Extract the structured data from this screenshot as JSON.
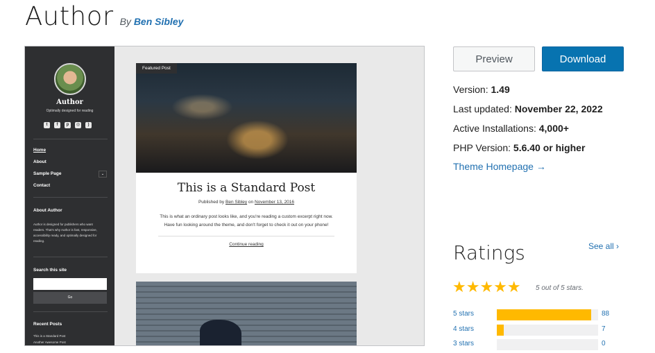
{
  "theme": {
    "title": "Author",
    "by_prefix": "By",
    "author": "Ben Sibley"
  },
  "screenshot": {
    "sidebar": {
      "site_name": "Author",
      "site_description": "Optimally designed for reading",
      "social_icons": [
        "twitter-icon",
        "facebook-icon",
        "pinterest-icon",
        "instagram-icon",
        "rss-icon"
      ],
      "menu": [
        "Home",
        "About",
        "Sample Page",
        "Contact"
      ],
      "submenu_toggle": "⌄",
      "about_heading": "About Author",
      "about_text": "Author is designed for publishers who want readers. That's why Author is fast, responsive, accessibility ready, and optimally designed for reading.",
      "search_heading": "Search this site",
      "search_button": "Go",
      "recent_heading": "Recent Posts",
      "recent_posts": [
        "This is a Standard Post",
        "Another Awesome Post"
      ]
    },
    "post": {
      "badge": "Featured Post",
      "title": "This is a Standard Post",
      "meta_prefix": "Published by",
      "meta_author": "Ben Sibley",
      "meta_on": "on",
      "meta_date": "November 13, 2016",
      "excerpt": "This is what an ordinary post looks like, and you're reading a custom excerpt right now. Have fun looking around the theme, and don't forget to check it out on your phone!",
      "continue": "Continue reading"
    }
  },
  "actions": {
    "preview": "Preview",
    "download": "Download"
  },
  "meta": {
    "version_label": "Version:",
    "version": "1.49",
    "updated_label": "Last updated:",
    "updated": "November 22, 2022",
    "installs_label": "Active Installations:",
    "installs": "4,000+",
    "php_label": "PHP Version:",
    "php": "5.6.40 or higher",
    "homepage": "Theme Homepage →"
  },
  "ratings": {
    "heading": "Ratings",
    "see_all": "See all ›",
    "stars_glyphs": "★★★★★",
    "summary": "5 out of 5 stars.",
    "rows": [
      {
        "label": "5 stars",
        "count": "88",
        "fraction": 0.93
      },
      {
        "label": "4 stars",
        "count": "7",
        "fraction": 0.07
      },
      {
        "label": "3 stars",
        "count": "0",
        "fraction": 0
      }
    ]
  },
  "colors": {
    "accent": "#2271b1",
    "download": "#0773b0",
    "star": "#ffb900",
    "sidebar": "#2e2f31"
  }
}
